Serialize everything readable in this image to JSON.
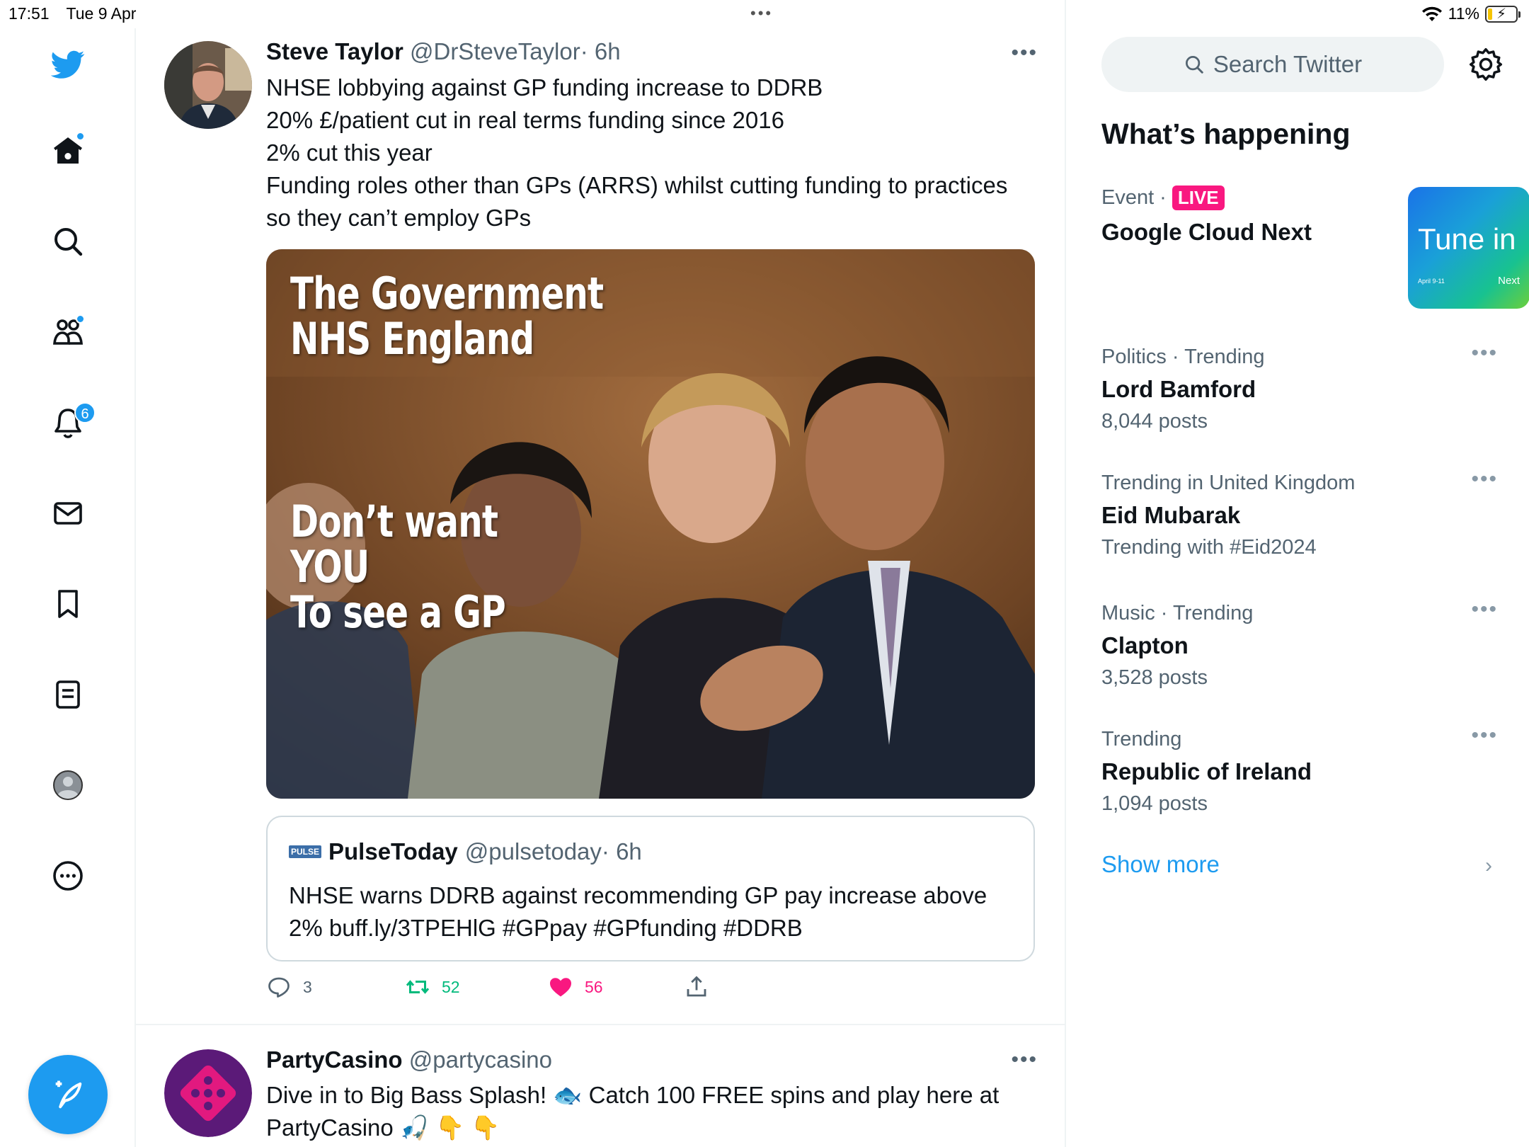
{
  "status_bar": {
    "time": "17:51",
    "date": "Tue 9 Apr",
    "battery": "11%"
  },
  "sidebar": {
    "notifications_count": "6",
    "items": [
      "twitter-logo",
      "home",
      "explore",
      "communities",
      "notifications",
      "messages",
      "bookmarks",
      "lists",
      "profile",
      "more"
    ]
  },
  "tweets": [
    {
      "name": "Steve Taylor",
      "handle": "@DrSteveTaylor",
      "time": "· 6h",
      "lines": [
        "NHSE lobbying against GP funding increase to DDRB",
        "20% £/patient cut in real terms funding since 2016",
        "2% cut this year",
        "Funding roles other than GPs (ARRS) whilst cutting funding to practices",
        "so they can’t employ GPs"
      ],
      "media_text": {
        "line1": "The Government",
        "line2": "NHS England",
        "line3": "Don’t want",
        "line4": "YOU",
        "line5": "To see a GP"
      },
      "quote": {
        "logo": "PULSE",
        "name": "PulseToday",
        "handle": "@pulsetoday",
        "time": "· 6h",
        "lines": [
          "NHSE warns DDRB against recommending GP pay increase above",
          "2% buff.ly/3TPEHlG #GPpay #GPfunding #DDRB"
        ]
      },
      "actions": {
        "replies": "3",
        "retweets": "52",
        "likes": "56"
      }
    },
    {
      "name": "PartyCasino",
      "handle": "@partycasino",
      "lines": [
        "Dive in to Big Bass Splash! 🐟 Catch 100 FREE spins and play here at",
        "PartyCasino 🎣 👇 👇"
      ]
    }
  ],
  "right": {
    "search_placeholder": "Search Twitter",
    "section_title": "What’s happening",
    "event": {
      "category": "Event",
      "live": "LIVE",
      "title": "Google Cloud Next",
      "image_text": "Tune in",
      "image_date": "April 9-11",
      "image_brand": "Next"
    },
    "trends": [
      {
        "category": "Politics · Trending",
        "name": "Lord Bamford",
        "posts": "8,044 posts"
      },
      {
        "category": "Trending in United Kingdom",
        "name": "Eid Mubarak",
        "posts": "Trending with #Eid2024"
      },
      {
        "category": "Music · Trending",
        "name": "Clapton",
        "posts": "3,528 posts"
      },
      {
        "category": "Trending",
        "name": "Republic of Ireland",
        "posts": "1,094 posts"
      }
    ],
    "show_more": "Show more"
  },
  "colors": {
    "accent": "#1d9bf0",
    "like": "#f91880",
    "retweet": "#00ba7c",
    "text_secondary": "#536471"
  }
}
